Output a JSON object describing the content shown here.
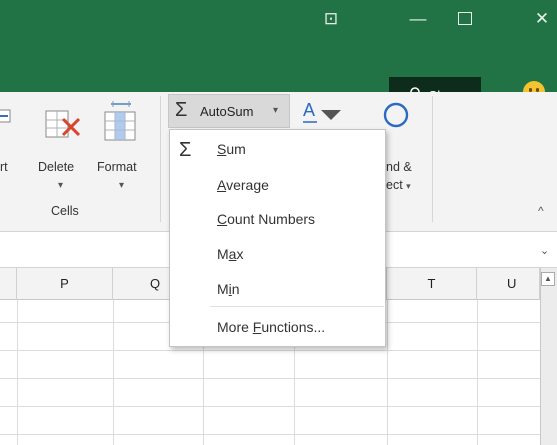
{
  "window": {
    "controls": [
      {
        "name": "ribbon-display-options-button",
        "glyph": "⊡"
      },
      {
        "name": "minimize-button",
        "glyph": "—"
      },
      {
        "name": "restore-button",
        "glyph": ""
      },
      {
        "name": "close-button",
        "glyph": "✕"
      }
    ]
  },
  "header": {
    "share_label": "Share"
  },
  "ribbon": {
    "insert_label_partial": "rt",
    "delete_label": "Delete",
    "format_label": "Format",
    "cells_group_label": "Cells",
    "autosum_label": "AutoSum",
    "find_select_line1": "nd &",
    "find_select_line2": "ect"
  },
  "columns": [
    "P",
    "Q",
    "T",
    "U"
  ],
  "autosum_menu": {
    "items": [
      {
        "id": "sum",
        "label": "Sum",
        "underline_index": 0
      },
      {
        "id": "average",
        "label": "Average",
        "underline_index": 0
      },
      {
        "id": "count-numbers",
        "label": "Count Numbers",
        "underline_index": 0
      },
      {
        "id": "max",
        "label": "Max",
        "underline_index": 1
      },
      {
        "id": "min",
        "label": "Min",
        "underline_index": 1
      },
      {
        "id": "more-functions",
        "label": "More Functions...",
        "underline_index": 5
      }
    ]
  },
  "colors": {
    "excel_green": "#217346",
    "share_bg": "#0e2c1b",
    "ribbon_bg": "#f3f3f3"
  }
}
